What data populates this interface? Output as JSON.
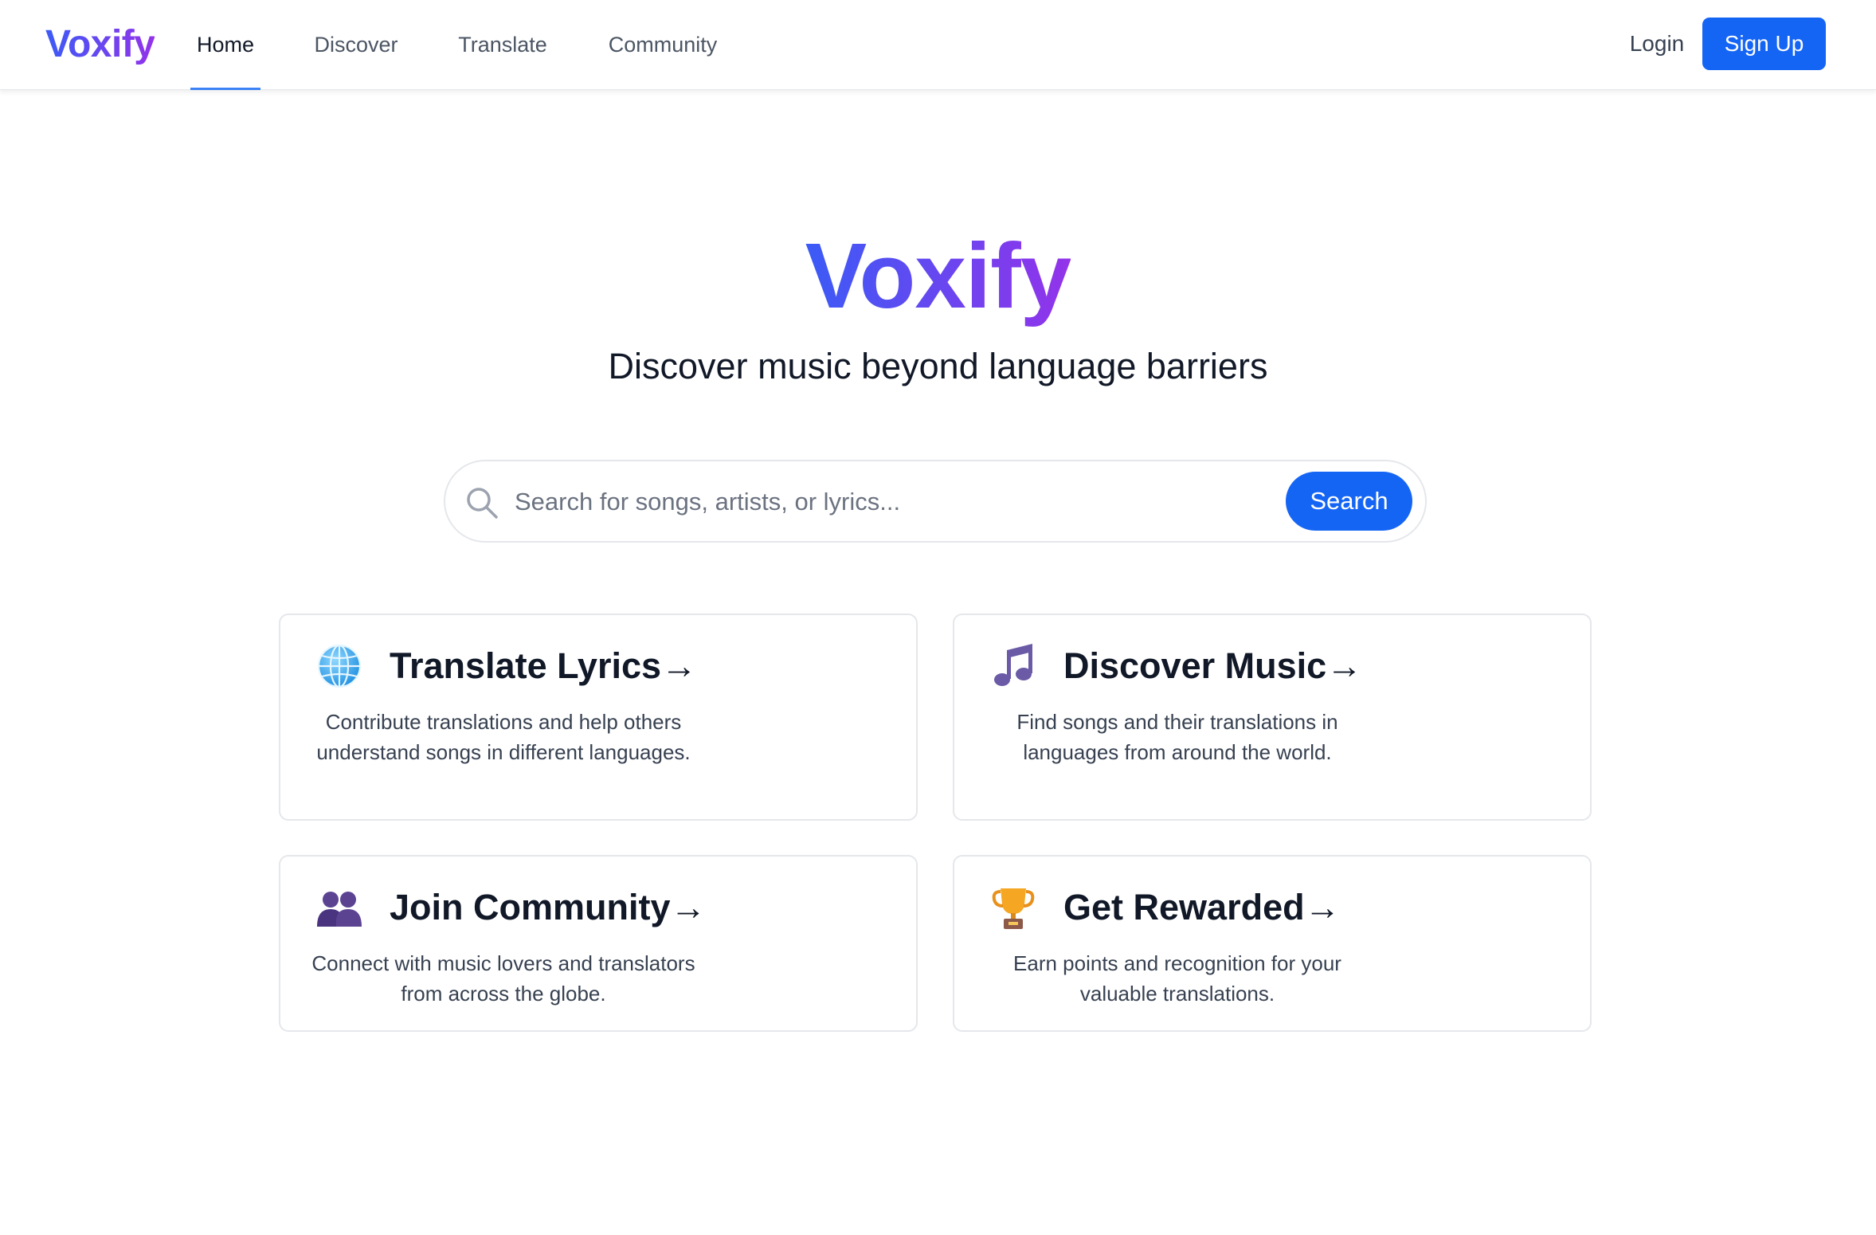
{
  "nav": {
    "logo": "Voxify",
    "links": [
      {
        "label": "Home",
        "active": true
      },
      {
        "label": "Discover",
        "active": false
      },
      {
        "label": "Translate",
        "active": false
      },
      {
        "label": "Community",
        "active": false
      }
    ],
    "login_label": "Login",
    "signup_label": "Sign Up"
  },
  "hero": {
    "title": "Voxify",
    "subtitle": "Discover music beyond language barriers"
  },
  "search": {
    "placeholder": "Search for songs, artists, or lyrics...",
    "value": "",
    "button_label": "Search"
  },
  "cards": [
    {
      "icon": "globe-icon",
      "title": "Translate Lyrics→",
      "description": "Contribute translations and help others understand songs in different languages."
    },
    {
      "icon": "music-note-icon",
      "title": "Discover Music→",
      "description": "Find songs and their translations in languages from around the world."
    },
    {
      "icon": "people-icon",
      "title": "Join Community→",
      "description": "Connect with music lovers and translators from across the globe."
    },
    {
      "icon": "trophy-icon",
      "title": "Get Rewarded→",
      "description": "Earn points and recognition for your valuable translations."
    }
  ],
  "colors": {
    "brand_start": "#3b5bf6",
    "brand_end": "#9333ea",
    "primary_button": "#1565f5",
    "active_tab_underline": "#3b82f6"
  }
}
